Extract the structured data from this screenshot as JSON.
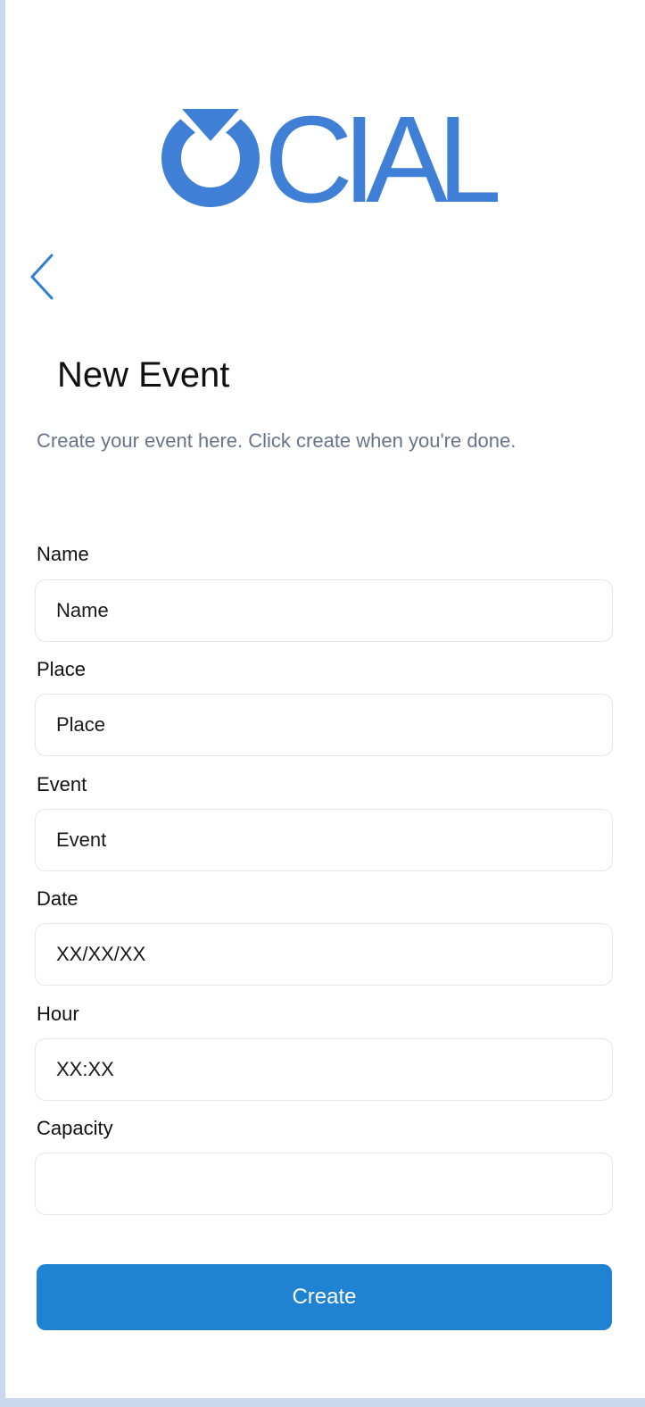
{
  "brand": {
    "logo_text": "OCIAL",
    "logo_color": "#3f7fd6"
  },
  "nav": {
    "back_icon": "chevron-left-icon"
  },
  "form": {
    "title": "New Event",
    "subtitle": "Create your event here. Click create when you're done.",
    "fields": [
      {
        "label": "Name",
        "placeholder": "Name"
      },
      {
        "label": "Place",
        "placeholder": "Place"
      },
      {
        "label": "Event",
        "placeholder": "Event"
      },
      {
        "label": "Date",
        "placeholder": "XX/XX/XX"
      },
      {
        "label": "Hour",
        "placeholder": "XX:XX"
      },
      {
        "label": "Capacity",
        "placeholder": ""
      }
    ],
    "submit_label": "Create",
    "accent_color": "#1f82d3"
  }
}
